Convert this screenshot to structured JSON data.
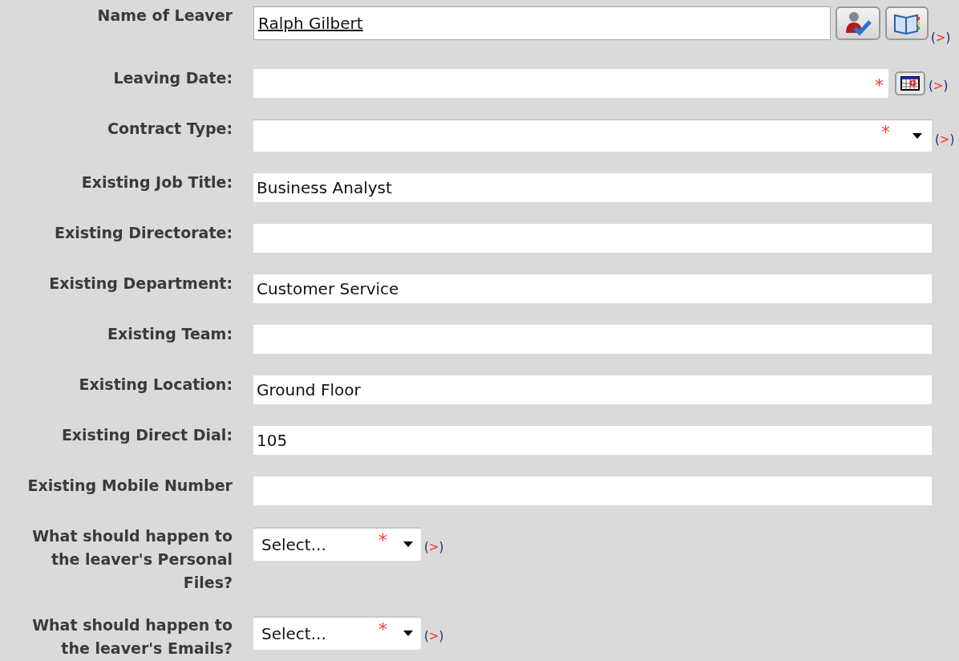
{
  "fields": [
    {
      "kind": "lookup",
      "label": "Name of Leaver",
      "value": "Ralph Gilbert",
      "marker": "(>)"
    },
    {
      "kind": "date",
      "label": "Leaving Date:",
      "required_mark": "*",
      "marker": "(>)"
    },
    {
      "kind": "dropdown",
      "label": "Contract Type:",
      "required_mark": "*",
      "marker": "(>)"
    },
    {
      "kind": "text",
      "label": "Existing Job Title:",
      "value": "Business Analyst"
    },
    {
      "kind": "text",
      "label": "Existing Directorate:"
    },
    {
      "kind": "text",
      "label": "Existing Department:",
      "value": "Customer Service"
    },
    {
      "kind": "text",
      "label": "Existing Team:"
    },
    {
      "kind": "text",
      "label": "Existing Location:",
      "value": "Ground Floor"
    },
    {
      "kind": "text",
      "label": "Existing Direct Dial:",
      "value": "105"
    },
    {
      "kind": "text",
      "label": "Existing Mobile Number"
    },
    {
      "kind": "select",
      "label": "What should happen to the leaver's Personal Files?",
      "value": "Select...",
      "required_mark": "*",
      "marker": "(>)"
    },
    {
      "kind": "select",
      "label": "What should happen to the leaver's Emails?",
      "value": "Select...",
      "required_mark": "*",
      "marker": "(>)"
    }
  ]
}
